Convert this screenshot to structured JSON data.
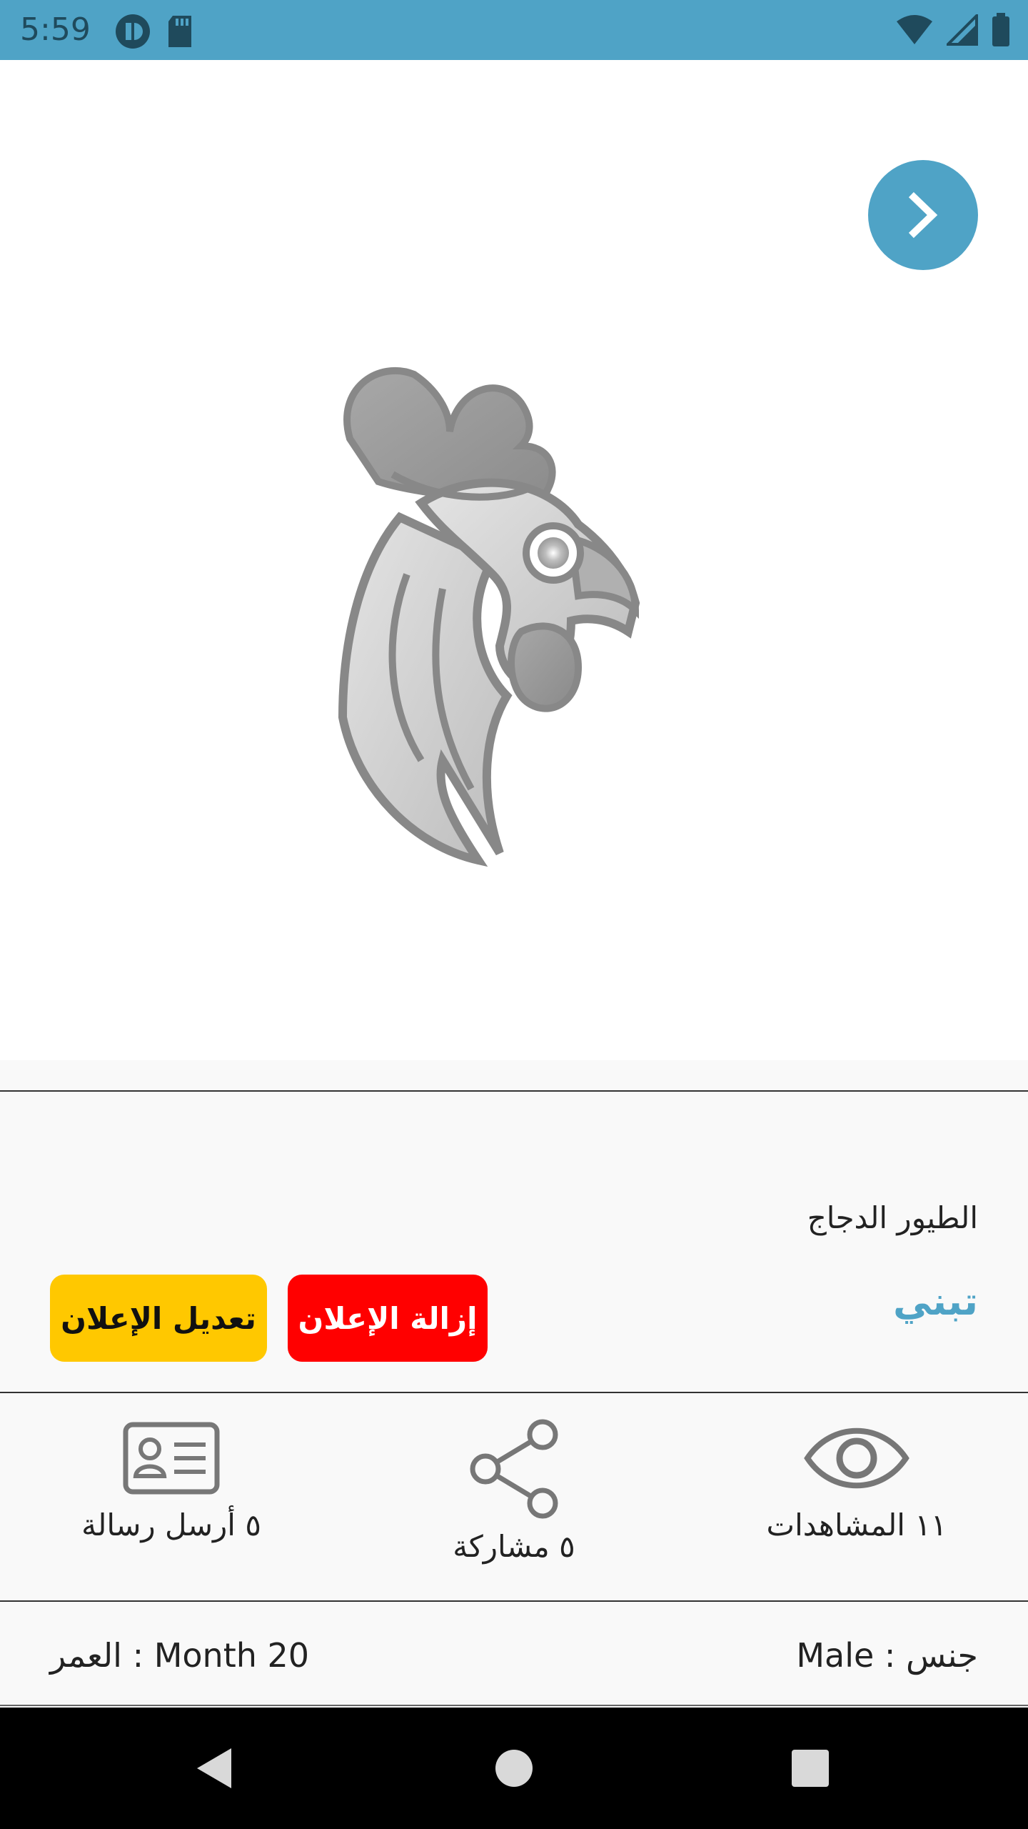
{
  "status_bar": {
    "time": "5:59",
    "bg_color": "#4fa3c6"
  },
  "image": {
    "icon": "rooster-icon"
  },
  "ad": {
    "category": "الطيور  الدجاج",
    "title": "تبني",
    "edit_button": "تعديل الإعلان",
    "remove_button": "إزالة الإعلان",
    "accent_color": "#4fa3c6",
    "edit_color": "#ffc800",
    "remove_color": "#ff0000"
  },
  "stats": {
    "views": "١١ المشاهدات",
    "shares": "٥ مشاركة",
    "messages": "٥ أرسل رسالة"
  },
  "info": {
    "age": "العمر : Month 20",
    "gender": "جنس : Male"
  }
}
